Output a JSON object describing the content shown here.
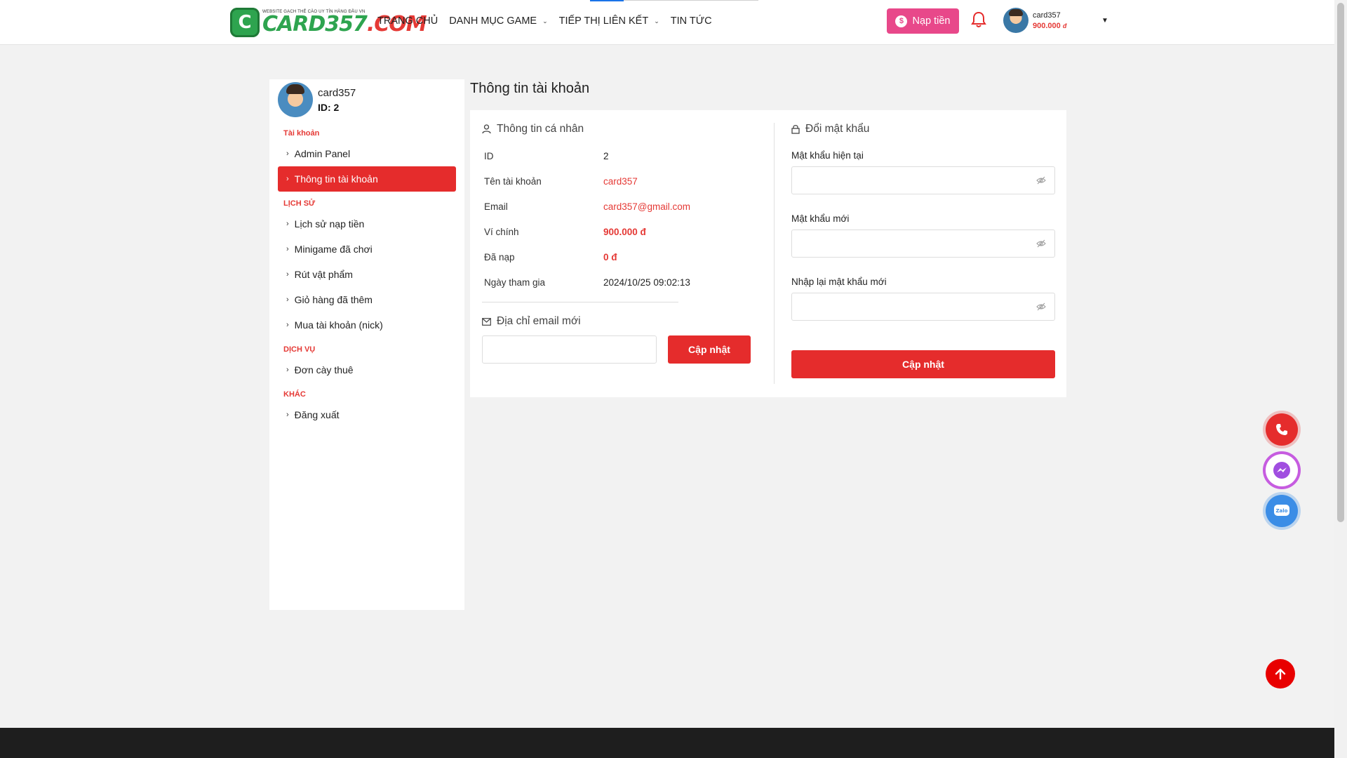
{
  "header": {
    "logo": {
      "tagline": "WEBSITE GẠCH THẺ CÀO UY TÍN HÀNG ĐẦU VN",
      "text_main": "CARD357",
      "text_suffix": ".COM"
    },
    "nav": [
      {
        "label": "TRANG CHỦ",
        "has_dropdown": false
      },
      {
        "label": "DANH MỤC GAME",
        "has_dropdown": true
      },
      {
        "label": "TIẾP THỊ LIÊN KẾT",
        "has_dropdown": true
      },
      {
        "label": "TIN TỨC",
        "has_dropdown": false
      }
    ],
    "topup_label": "Nạp tiền",
    "user": {
      "name": "card357",
      "balance": "900.000",
      "currency": "đ"
    }
  },
  "sidebar": {
    "profile": {
      "name": "card357",
      "id_text": "ID: 2"
    },
    "sections": [
      {
        "title": "Tài khoản",
        "items": [
          "Admin Panel",
          "Thông tin tài khoản"
        ]
      },
      {
        "title": "LỊCH SỬ",
        "items": [
          "Lịch sử nạp tiền",
          "Minigame đã chơi",
          "Rút vật phẩm",
          "Giỏ hàng đã thêm",
          "Mua tài khoản (nick)"
        ]
      },
      {
        "title": "DỊCH VỤ",
        "items": [
          "Đơn cày thuê"
        ]
      },
      {
        "title": "KHÁC",
        "items": [
          "Đăng xuất"
        ]
      }
    ],
    "active_item": "Thông tin tài khoản"
  },
  "main": {
    "title": "Thông tin tài khoản",
    "personal": {
      "heading": "Thông tin cá nhân",
      "rows": [
        {
          "label": "ID",
          "value": "2"
        },
        {
          "label": "Tên tài khoản",
          "value": "card357"
        },
        {
          "label": "Email",
          "value": "card357@gmail.com"
        },
        {
          "label": "Ví chính",
          "value": "900.000 đ"
        },
        {
          "label": "Đã nạp",
          "value": "0 đ"
        },
        {
          "label": "Ngày tham gia",
          "value": "2024/10/25 09:02:13"
        }
      ]
    },
    "email_change": {
      "heading": "Địa chỉ email mới",
      "input_value": "",
      "button": "Cập nhật"
    },
    "password_change": {
      "heading": "Đổi mật khẩu",
      "fields": [
        {
          "label": "Mật khẩu hiện tại",
          "value": ""
        },
        {
          "label": "Mật khẩu mới",
          "value": ""
        },
        {
          "label": "Nhập lại mật khẩu mới",
          "value": ""
        }
      ],
      "button": "Cập nhật"
    }
  },
  "floating": {
    "icons": [
      "phone-icon",
      "messenger-icon",
      "zalo-icon",
      "arrow-up-icon"
    ]
  },
  "colors": {
    "accent_red": "#e52c2c",
    "topup_pink": "#e8488a",
    "brand_green": "#2ea44f"
  }
}
